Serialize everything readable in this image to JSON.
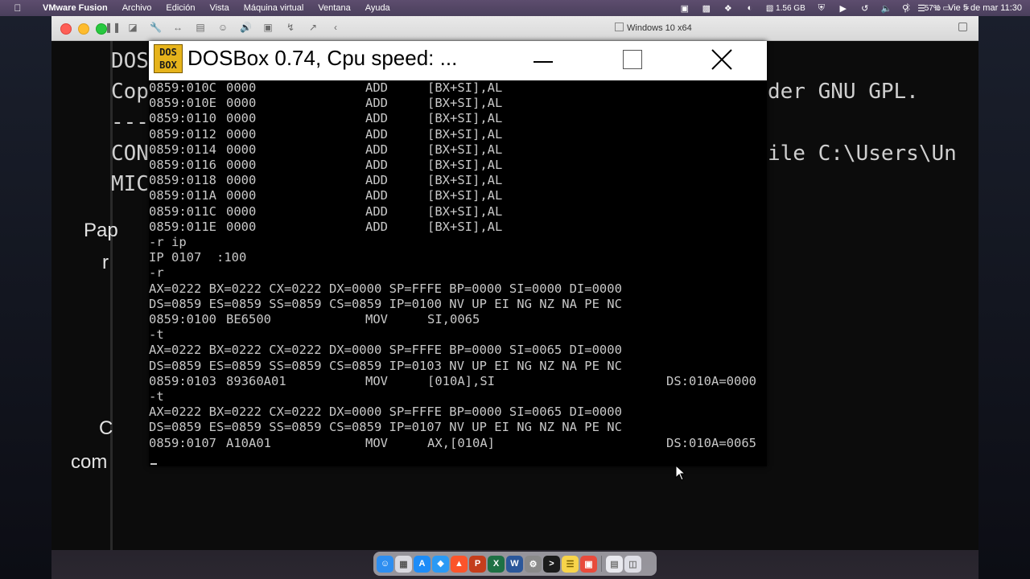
{
  "menubar": {
    "app_name": "VMware Fusion",
    "menus": [
      "Archivo",
      "Edición",
      "Vista",
      "Máquina virtual",
      "Ventana",
      "Ayuda"
    ],
    "memory": "1.56 GB",
    "battery": "57%",
    "datetime": "Vie 5 de mar  11:30"
  },
  "vmware": {
    "vm_name": "Windows 10 x64"
  },
  "background_cmd": {
    "lines": [
      "DOS",
      "Cop",
      "---",
      "CON",
      "MIC"
    ],
    "right_texts": [
      "der GNU GPL.",
      "ile C:\\Users\\Un"
    ],
    "side_texts": [
      "Pap",
      "r",
      "C",
      "com"
    ]
  },
  "dosbox": {
    "logo_top": "DOS",
    "logo_bottom": "BOX",
    "title": "DOSBox 0.74, Cpu speed:     ...",
    "lines": [
      {
        "addr": "0859:010C",
        "hex": "0000",
        "op": "ADD",
        "arg": "[BX+SI],AL",
        "extra": ""
      },
      {
        "addr": "0859:010E",
        "hex": "0000",
        "op": "ADD",
        "arg": "[BX+SI],AL",
        "extra": ""
      },
      {
        "addr": "0859:0110",
        "hex": "0000",
        "op": "ADD",
        "arg": "[BX+SI],AL",
        "extra": ""
      },
      {
        "addr": "0859:0112",
        "hex": "0000",
        "op": "ADD",
        "arg": "[BX+SI],AL",
        "extra": ""
      },
      {
        "addr": "0859:0114",
        "hex": "0000",
        "op": "ADD",
        "arg": "[BX+SI],AL",
        "extra": ""
      },
      {
        "addr": "0859:0116",
        "hex": "0000",
        "op": "ADD",
        "arg": "[BX+SI],AL",
        "extra": ""
      },
      {
        "addr": "0859:0118",
        "hex": "0000",
        "op": "ADD",
        "arg": "[BX+SI],AL",
        "extra": ""
      },
      {
        "addr": "0859:011A",
        "hex": "0000",
        "op": "ADD",
        "arg": "[BX+SI],AL",
        "extra": ""
      },
      {
        "addr": "0859:011C",
        "hex": "0000",
        "op": "ADD",
        "arg": "[BX+SI],AL",
        "extra": ""
      },
      {
        "addr": "0859:011E",
        "hex": "0000",
        "op": "ADD",
        "arg": "[BX+SI],AL",
        "extra": ""
      },
      {
        "text": "-r ip"
      },
      {
        "text": "IP 0107  :100"
      },
      {
        "text": "-r"
      },
      {
        "text": "AX=0222 BX=0222 CX=0222 DX=0000 SP=FFFE BP=0000 SI=0000 DI=0000"
      },
      {
        "text": "DS=0859 ES=0859 SS=0859 CS=0859 IP=0100 NV UP EI NG NZ NA PE NC"
      },
      {
        "addr": "0859:0100",
        "hex": "BE6500",
        "op": "MOV",
        "arg": "SI,0065",
        "extra": ""
      },
      {
        "text": "-t"
      },
      {
        "text": "AX=0222 BX=0222 CX=0222 DX=0000 SP=FFFE BP=0000 SI=0065 DI=0000"
      },
      {
        "text": "DS=0859 ES=0859 SS=0859 CS=0859 IP=0103 NV UP EI NG NZ NA PE NC"
      },
      {
        "addr": "0859:0103",
        "hex": "89360A01",
        "op": "MOV",
        "arg": "[010A],SI",
        "extra": "DS:010A=0000"
      },
      {
        "text": "-t"
      },
      {
        "text": "AX=0222 BX=0222 CX=0222 DX=0000 SP=FFFE BP=0000 SI=0065 DI=0000"
      },
      {
        "text": "DS=0859 ES=0859 SS=0859 CS=0859 IP=0107 NV UP EI NG NZ NA PE NC"
      },
      {
        "addr": "0859:0107",
        "hex": "A10A01",
        "op": "MOV",
        "arg": "AX,[010A]",
        "extra": "DS:010A=0065"
      }
    ]
  },
  "dock": {
    "icons": [
      "finder-icon",
      "launchpad-icon",
      "app-store-icon",
      "safari-icon",
      "brave-icon",
      "powerpoint-icon",
      "excel-icon",
      "word-icon",
      "settings-icon",
      "terminal-icon",
      "notes-icon",
      "vmware-icon",
      "documents-icon",
      "trash-icon"
    ]
  }
}
